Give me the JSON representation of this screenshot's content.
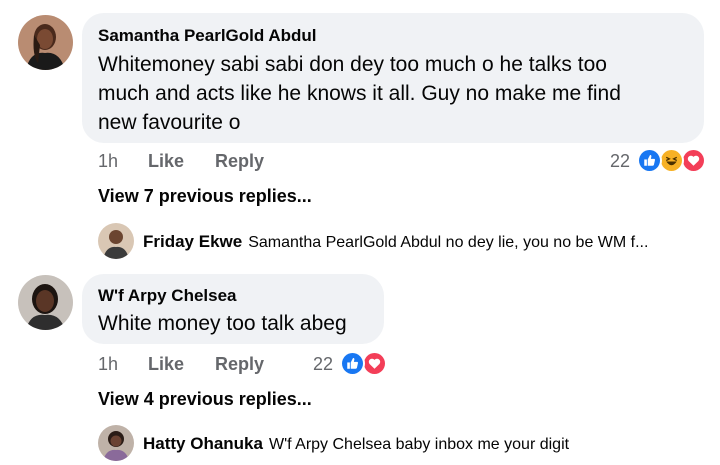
{
  "comments": [
    {
      "author": "Samantha PearlGold Abdul",
      "text_lines": [
        "Whitemoney sabi sabi don dey too much o he talks too",
        "much and acts like he knows it all. Guy no make me find",
        "new favourite o"
      ],
      "time": "1h",
      "like_label": "Like",
      "reply_label": "Reply",
      "reaction_count": "22",
      "reactions": [
        "like-icon",
        "haha-icon",
        "love-icon"
      ],
      "view_replies": "View 7 previous replies...",
      "latest_reply": {
        "author": "Friday Ekwe",
        "text": "Samantha PearlGold Abdul no dey lie, you no be WM f..."
      }
    },
    {
      "author": "W'f Arpy Chelsea",
      "text_lines": [
        "White money too talk abeg"
      ],
      "time": "1h",
      "like_label": "Like",
      "reply_label": "Reply",
      "reaction_count": "22",
      "reactions": [
        "like-icon",
        "love-icon"
      ],
      "view_replies": "View 4 previous replies...",
      "latest_reply": {
        "author": "Hatty Ohanuka",
        "text": "W'f Arpy Chelsea baby inbox me your digit"
      }
    }
  ],
  "colors": {
    "bubble": "#f0f2f5",
    "meta_text": "#65676b",
    "like_blue": "#1877f2",
    "love_red": "#f33e58",
    "haha_yellow": "#f7b125"
  }
}
